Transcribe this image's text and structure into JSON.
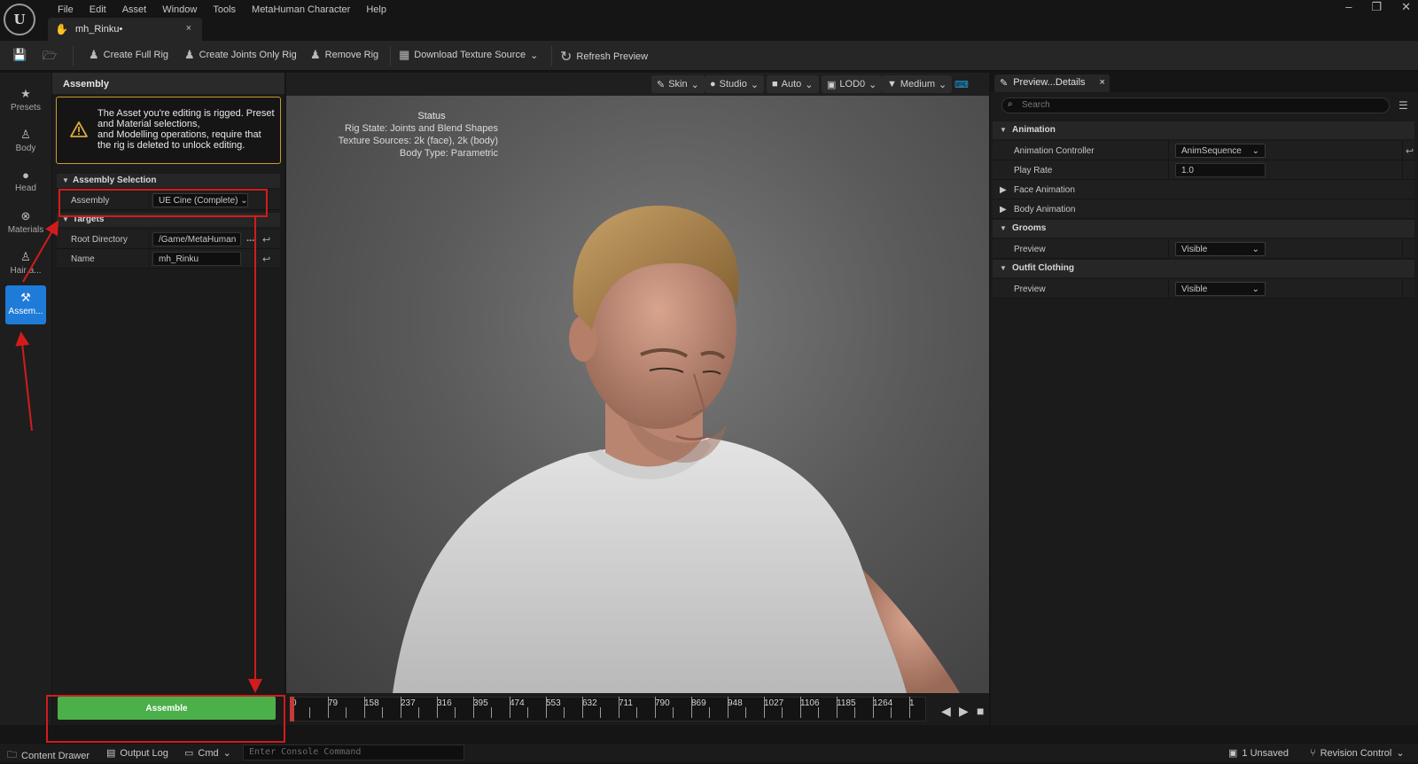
{
  "app": {
    "logo": "U"
  },
  "menu": [
    "File",
    "Edit",
    "Asset",
    "Window",
    "Tools",
    "MetaHuman Character",
    "Help"
  ],
  "document_tab": {
    "title": "mh_Rinku•",
    "close": "×"
  },
  "window_controls": {
    "minimize": "–",
    "restore": "❐",
    "close": "✕"
  },
  "toolbar": {
    "create_full_rig": "Create Full Rig",
    "create_joints_only_rig": "Create Joints Only Rig",
    "remove_rig": "Remove Rig",
    "download_texture_source": "Download Texture Source",
    "refresh_preview": "Refresh Preview"
  },
  "left_strip": [
    {
      "label": "Presets",
      "icon": "star-icon"
    },
    {
      "label": "Body",
      "icon": "body-icon"
    },
    {
      "label": "Head",
      "icon": "head-icon"
    },
    {
      "label": "Materials",
      "icon": "materials-icon"
    },
    {
      "label": "Hair a...",
      "icon": "hair-icon"
    },
    {
      "label": "Assem...",
      "icon": "hammer-icon",
      "active": true
    }
  ],
  "assembly_panel": {
    "header": "Assembly",
    "warning": [
      "The Asset you're editing is rigged. Preset",
      "and Material selections,",
      "and Modelling operations, require that",
      "the rig is deleted to unlock editing."
    ],
    "section_selection": "Assembly Selection",
    "assembly_label": "Assembly",
    "assembly_value": "UE Cine (Complete)",
    "section_targets": "Targets",
    "root_directory_label": "Root Directory",
    "root_directory_value": "/Game/MetaHuman",
    "browse": "...",
    "name_label": "Name",
    "name_value": "mh_Rinku",
    "assemble_button": "Assemble"
  },
  "viewport": {
    "buttons": {
      "skin": "Skin",
      "studio": "Studio",
      "auto": "Auto",
      "lod": "LOD0",
      "quality": "Medium"
    },
    "status": {
      "title": "Status",
      "rig_state": "Rig State: Joints and Blend Shapes",
      "texture_sources": "Texture Sources: 2k (face), 2k (body)",
      "body_type": "Body Type: Parametric"
    }
  },
  "timeline": {
    "ticks": [
      "0",
      "79",
      "158",
      "237",
      "316",
      "395",
      "474",
      "553",
      "632",
      "711",
      "790",
      "869",
      "948",
      "1027",
      "1106",
      "1185",
      "1264",
      "1"
    ]
  },
  "details": {
    "tab_title": "Preview...Details",
    "search_placeholder": "Search",
    "sections": [
      {
        "title": "Animation",
        "rows": [
          {
            "label": "Animation Controller",
            "value": "AnimSequence",
            "type": "combo"
          },
          {
            "label": "Play Rate",
            "value": "1.0",
            "type": "number"
          }
        ]
      },
      {
        "title": "Face Animation",
        "collapsed": true
      },
      {
        "title": "Body Animation",
        "collapsed": true
      },
      {
        "title": "Grooms",
        "rows": [
          {
            "label": "Preview",
            "value": "Visible",
            "type": "combo"
          }
        ]
      },
      {
        "title": "Outfit Clothing",
        "rows": [
          {
            "label": "Preview",
            "value": "Visible",
            "type": "combo"
          }
        ]
      }
    ]
  },
  "status_bar": {
    "content_drawer": "Content Drawer",
    "output_log": "Output Log",
    "cmd": "Cmd",
    "console_placeholder": "Enter Console Command",
    "unsaved": "1 Unsaved",
    "revision_control": "Revision Control"
  },
  "colors": {
    "accent_blue": "#1e7bd8",
    "assemble_green": "#4bb04a",
    "annotation_red": "#d21c1c",
    "warning_amber": "#c79a2c"
  }
}
